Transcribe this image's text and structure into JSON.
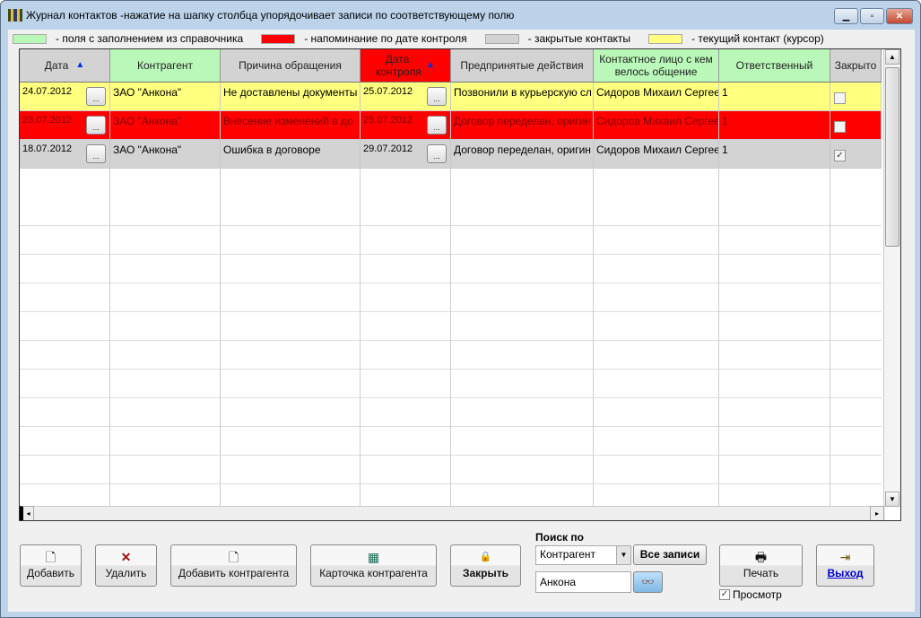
{
  "window": {
    "title": "Журнал контактов -нажатие на шапку столбца упорядочивает записи по соответствующему полю"
  },
  "legend": [
    {
      "color": "#b9f8b9",
      "label": "- поля с заполнением из справочника"
    },
    {
      "color": "#ff0000",
      "label": "- напоминание по дате контроля"
    },
    {
      "color": "#d3d3d3",
      "label": "- закрытые контакты"
    },
    {
      "color": "#ffff80",
      "label": "- текущий контакт (курсор)"
    }
  ],
  "columns": [
    "Дата",
    "Контрагент",
    "Причина обращения",
    "Дата контроля",
    "Предпринятые действия",
    "Контактное лицо с кем велось общение",
    "Ответственный",
    "Закрыто"
  ],
  "rows": [
    {
      "date": "24.07.2012",
      "contractor": "ЗАО \"Анкона\"",
      "reason": "Не доставлены документы",
      "control_date": "25.07.2012",
      "actions": "Позвонили в курьерскую сл",
      "contact": "Сидоров Михаил Сергеевич",
      "responsible": "1",
      "closed": false,
      "bg": "#ffff80"
    },
    {
      "date": "23.07.2012",
      "contractor": "ЗАО \"Анкона\"",
      "reason": "Внесение изменений в до",
      "control_date": "25.07.2012",
      "actions": "Договор переделан, оригин",
      "contact": "Сидоров Михаил Сергеевич",
      "responsible": "1",
      "closed": false,
      "bg": "#ff0000"
    },
    {
      "date": "18.07.2012",
      "contractor": "ЗАО \"Анкона\"",
      "reason": "Ошибка в договоре",
      "control_date": "29.07.2012",
      "actions": "Договор переделан, оригин",
      "contact": "Сидоров Михаил Сергеевич",
      "responsible": "1",
      "closed": true,
      "bg": "#d3d3d3"
    }
  ],
  "toolbar": {
    "add": "Добавить",
    "delete": "Удалить",
    "add_contractor": "Добавить контрагента",
    "contractor_card": "Карточка контрагента",
    "close": "Закрыть",
    "print": "Печать",
    "exit": "Выход",
    "preview": "Просмотр"
  },
  "search": {
    "label": "Поиск по",
    "field": "Контрагент",
    "all_records": "Все записи",
    "value": "Анкона"
  }
}
